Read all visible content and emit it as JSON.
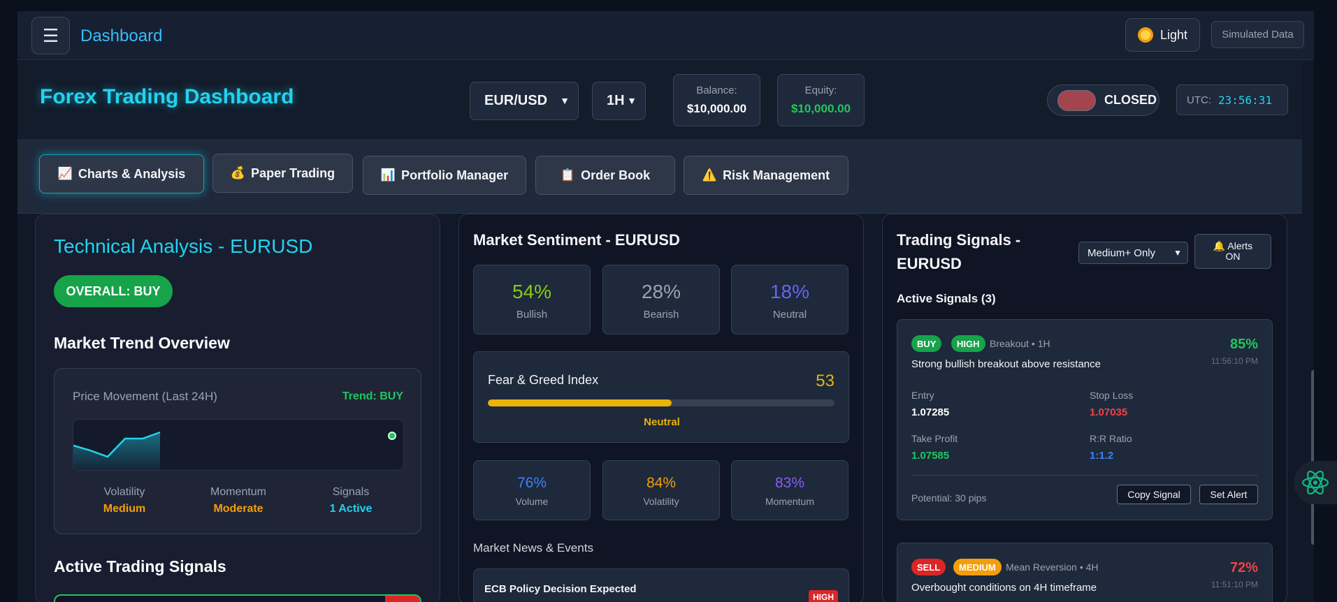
{
  "topbar": {
    "menu_icon": "menu-icon",
    "title": "Dashboard",
    "theme_label": "Light",
    "theme_icon": "sun-icon",
    "sim_badge": "Simulated Data"
  },
  "header": {
    "title": "Forex Trading Dashboard",
    "pair": "EUR/USD",
    "timeframe": "1H",
    "balance_label": "Balance:",
    "balance_value": "$10,000.00",
    "equity_label": "Equity:",
    "equity_value": "$10,000.00",
    "market_status": "CLOSED",
    "utc_label": "UTC:",
    "utc_time": "23:56:31"
  },
  "tabs": [
    {
      "label": "Charts & Analysis",
      "icon": "📈"
    },
    {
      "label": "Paper Trading",
      "icon": "💰"
    },
    {
      "label": "Portfolio Manager",
      "icon": "📊"
    },
    {
      "label": "Order Book",
      "icon": "📋"
    },
    {
      "label": "Risk Management",
      "icon": "⚠️"
    }
  ],
  "technical": {
    "title": "Technical Analysis - EURUSD",
    "overall": "OVERALL: BUY",
    "trend_heading": "Market Trend Overview",
    "price_label": "Price Movement (Last 24H)",
    "trend_label": "Trend: BUY",
    "metrics": [
      {
        "label": "Volatility",
        "value": "Medium",
        "color": "#f59e0b"
      },
      {
        "label": "Momentum",
        "value": "Moderate",
        "color": "#f59e0b"
      },
      {
        "label": "Signals",
        "value": "1 Active",
        "color": "#22d3ee"
      }
    ],
    "signals_heading": "Active Trading Signals"
  },
  "sentiment": {
    "title": "Market Sentiment - EURUSD",
    "boxes": [
      {
        "pct": "54%",
        "name": "Bullish",
        "color": "#84cc16"
      },
      {
        "pct": "28%",
        "name": "Bearish",
        "color": "#9ca3af"
      },
      {
        "pct": "18%",
        "name": "Neutral",
        "color": "#6366f1"
      }
    ],
    "fear_greed": {
      "title": "Fear & Greed Index",
      "value": "53",
      "fill": 0.53,
      "state": "Neutral"
    },
    "stats": [
      {
        "pct": "76%",
        "name": "Volume",
        "color": "#3b82f6"
      },
      {
        "pct": "84%",
        "name": "Volatility",
        "color": "#f59e0b"
      },
      {
        "pct": "83%",
        "name": "Momentum",
        "color": "#8b5cf6"
      }
    ],
    "news_heading": "Market News & Events",
    "news": [
      {
        "title": "ECB Policy Decision Expected",
        "impact": "HIGH"
      }
    ]
  },
  "signals": {
    "title": "Trading Signals - EURUSD",
    "filter": "Medium+ Only",
    "alerts_line1": "🔔 Alerts",
    "alerts_line2": "ON",
    "active_heading": "Active Signals (3)",
    "items": [
      {
        "side": "BUY",
        "side_color": "#16a34a",
        "level": "HIGH",
        "level_color": "#16a34a",
        "meta": "Breakout • 1H",
        "desc": "Strong bullish breakout above resistance",
        "confidence": "85%",
        "conf_color": "#22c55e",
        "time": "11:56:10 PM",
        "entry_label": "Entry",
        "entry": "1.07285",
        "sl_label": "Stop Loss",
        "sl": "1.07035",
        "tp_label": "Take Profit",
        "tp": "1.07585",
        "rr_label": "R:R Ratio",
        "rr": "1:1.2",
        "potential": "Potential: 30 pips",
        "copy_label": "Copy Signal",
        "alert_label": "Set Alert"
      },
      {
        "side": "SELL",
        "side_color": "#dc2626",
        "level": "MEDIUM",
        "level_color": "#f59e0b",
        "meta": "Mean Reversion • 4H",
        "desc": "Overbought conditions on 4H timeframe",
        "confidence": "72%",
        "conf_color": "#ef4444",
        "time": "11:51:10 PM"
      }
    ]
  },
  "colors": {
    "accent": "#22d3ee",
    "buy": "#16a34a",
    "sell": "#dc2626"
  }
}
